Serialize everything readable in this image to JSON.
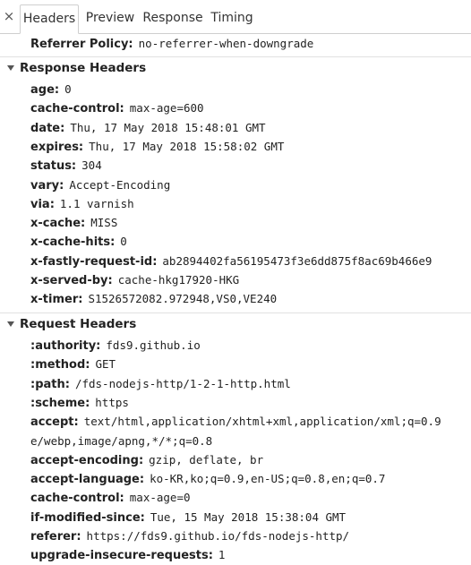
{
  "tabs": {
    "close_glyph": "×",
    "items": [
      "Headers",
      "Preview",
      "Response",
      "Timing"
    ],
    "active": "Headers"
  },
  "general": {
    "referrer_policy": {
      "key": "Referrer Policy:",
      "value": "no-referrer-when-downgrade"
    }
  },
  "response_headers": {
    "title": "Response Headers",
    "items": [
      {
        "key": "age:",
        "value": "0"
      },
      {
        "key": "cache-control:",
        "value": "max-age=600"
      },
      {
        "key": "date:",
        "value": "Thu, 17 May 2018 15:48:01 GMT"
      },
      {
        "key": "expires:",
        "value": "Thu, 17 May 2018 15:58:02 GMT"
      },
      {
        "key": "status:",
        "value": "304"
      },
      {
        "key": "vary:",
        "value": "Accept-Encoding"
      },
      {
        "key": "via:",
        "value": "1.1 varnish"
      },
      {
        "key": "x-cache:",
        "value": "MISS"
      },
      {
        "key": "x-cache-hits:",
        "value": "0"
      },
      {
        "key": "x-fastly-request-id:",
        "value": "ab2894402fa56195473f3e6dd875f8ac69b466e9"
      },
      {
        "key": "x-served-by:",
        "value": "cache-hkg17920-HKG"
      },
      {
        "key": "x-timer:",
        "value": "S1526572082.972948,VS0,VE240"
      }
    ]
  },
  "request_headers": {
    "title": "Request Headers",
    "items": [
      {
        "key": ":authority:",
        "value": "fds9.github.io"
      },
      {
        "key": ":method:",
        "value": "GET"
      },
      {
        "key": ":path:",
        "value": "/fds-nodejs-http/1-2-1-http.html"
      },
      {
        "key": ":scheme:",
        "value": "https"
      },
      {
        "key": "accept:",
        "value": "text/html,application/xhtml+xml,application/xml;q=0.9"
      },
      {
        "key": "",
        "value": "e/webp,image/apng,*/*;q=0.8"
      },
      {
        "key": "accept-encoding:",
        "value": "gzip, deflate, br"
      },
      {
        "key": "accept-language:",
        "value": "ko-KR,ko;q=0.9,en-US;q=0.8,en;q=0.7"
      },
      {
        "key": "cache-control:",
        "value": "max-age=0"
      },
      {
        "key": "if-modified-since:",
        "value": "Tue, 15 May 2018 15:38:04 GMT"
      },
      {
        "key": "referer:",
        "value": "https://fds9.github.io/fds-nodejs-http/"
      },
      {
        "key": "upgrade-insecure-requests:",
        "value": "1"
      }
    ]
  }
}
